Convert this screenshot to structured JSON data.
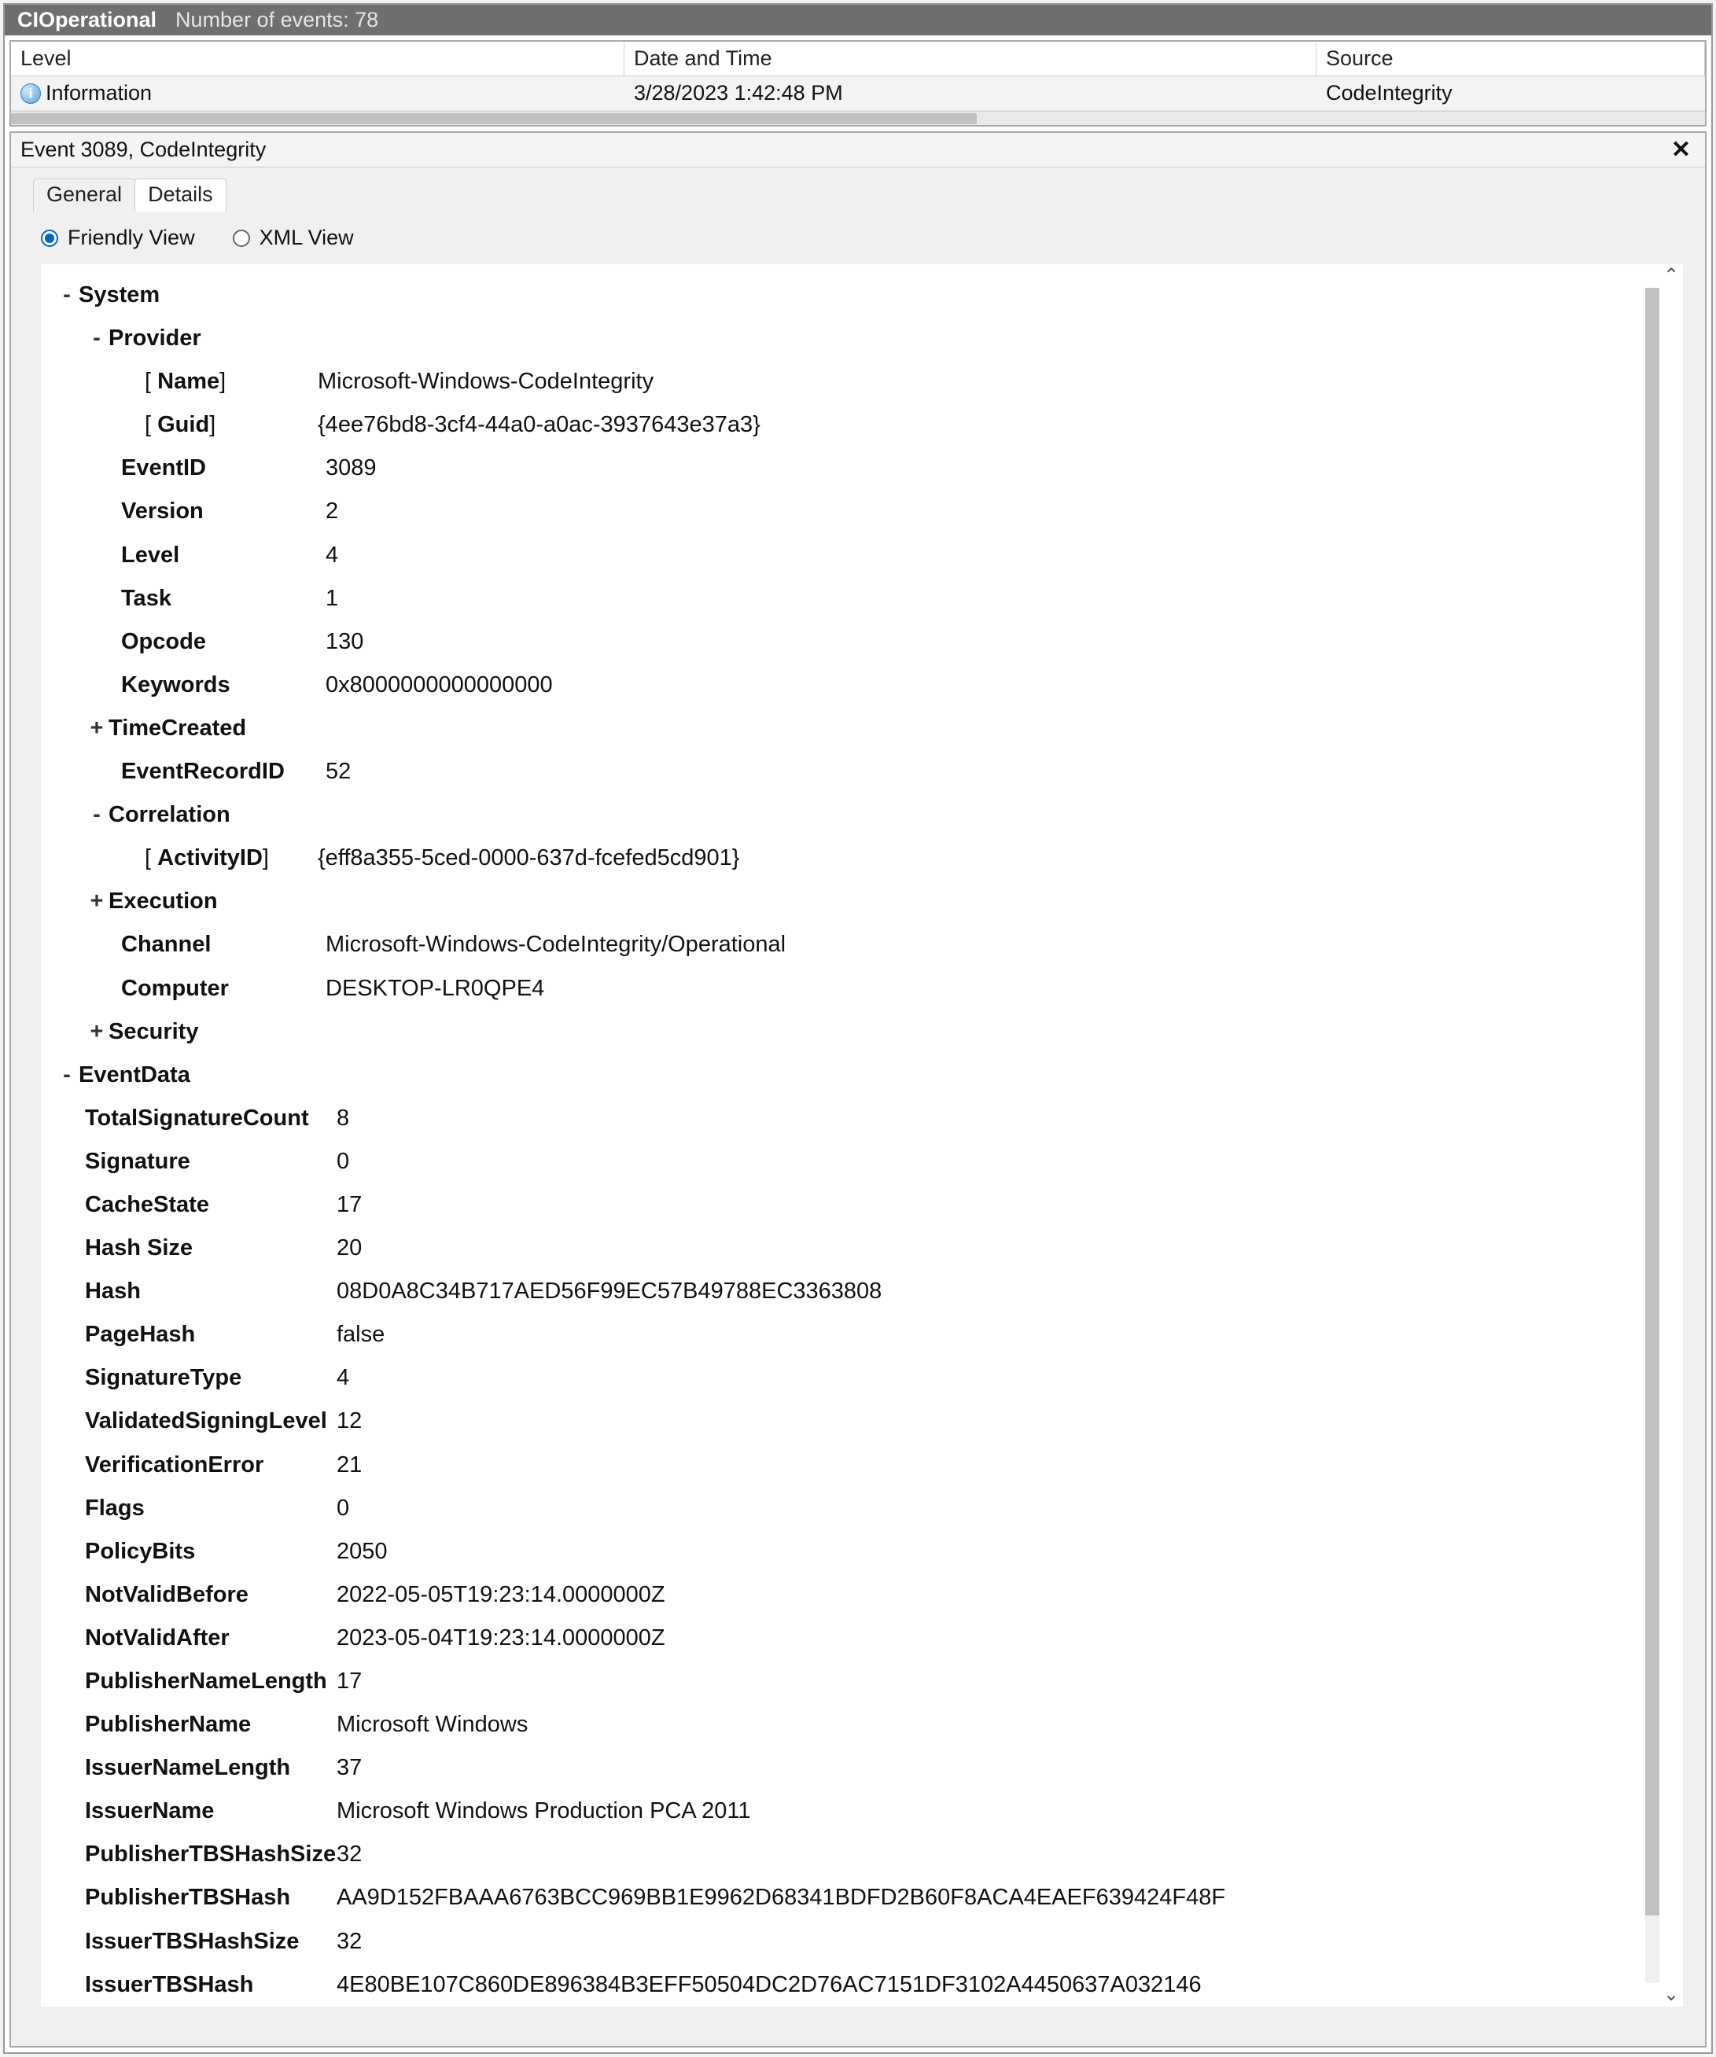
{
  "titlebar": {
    "name": "CIOperational",
    "count_label": "Number of events: 78"
  },
  "grid": {
    "headers": {
      "level": "Level",
      "date": "Date and Time",
      "source": "Source"
    },
    "rows": [
      {
        "level": "Information",
        "date": "3/28/2023 1:42:48 PM",
        "source": "CodeIntegrity"
      }
    ]
  },
  "detail_pane": {
    "title": "Event 3089, CodeIntegrity"
  },
  "tabs": {
    "general": "General",
    "details": "Details"
  },
  "viewmodes": {
    "friendly": "Friendly View",
    "xml": "XML View"
  },
  "tree": {
    "system": {
      "label": "System",
      "provider": {
        "label": "Provider",
        "name_label": "Name",
        "name_value": "Microsoft-Windows-CodeIntegrity",
        "guid_label": "Guid",
        "guid_value": "{4ee76bd8-3cf4-44a0-a0ac-3937643e37a3}"
      },
      "eventid": {
        "label": "EventID",
        "value": "3089"
      },
      "version": {
        "label": "Version",
        "value": "2"
      },
      "level": {
        "label": "Level",
        "value": "4"
      },
      "task": {
        "label": "Task",
        "value": "1"
      },
      "opcode": {
        "label": "Opcode",
        "value": "130"
      },
      "keywords": {
        "label": "Keywords",
        "value": "0x8000000000000000"
      },
      "timecreated": {
        "label": "TimeCreated"
      },
      "eventrecordid": {
        "label": "EventRecordID",
        "value": "52"
      },
      "correlation": {
        "label": "Correlation",
        "activityid_label": "ActivityID",
        "activityid_value": "{eff8a355-5ced-0000-637d-fcefed5cd901}"
      },
      "execution": {
        "label": "Execution"
      },
      "channel": {
        "label": "Channel",
        "value": "Microsoft-Windows-CodeIntegrity/Operational"
      },
      "computer": {
        "label": "Computer",
        "value": "DESKTOP-LR0QPE4"
      },
      "security": {
        "label": "Security"
      }
    },
    "eventdata": {
      "label": "EventData",
      "items": [
        {
          "k": "TotalSignatureCount",
          "v": "8"
        },
        {
          "k": "Signature",
          "v": "0"
        },
        {
          "k": "CacheState",
          "v": "17"
        },
        {
          "k": "Hash Size",
          "v": "20"
        },
        {
          "k": "Hash",
          "v": "08D0A8C34B717AED56F99EC57B49788EC3363808"
        },
        {
          "k": "PageHash",
          "v": "false"
        },
        {
          "k": "SignatureType",
          "v": "4"
        },
        {
          "k": "ValidatedSigningLevel",
          "v": "12"
        },
        {
          "k": "VerificationError",
          "v": "21"
        },
        {
          "k": "Flags",
          "v": "0"
        },
        {
          "k": "PolicyBits",
          "v": "2050"
        },
        {
          "k": "NotValidBefore",
          "v": "2022-05-05T19:23:14.0000000Z"
        },
        {
          "k": "NotValidAfter",
          "v": "2023-05-04T19:23:14.0000000Z"
        },
        {
          "k": "PublisherNameLength",
          "v": "17"
        },
        {
          "k": "PublisherName",
          "v": "Microsoft Windows"
        },
        {
          "k": "IssuerNameLength",
          "v": "37"
        },
        {
          "k": "IssuerName",
          "v": "Microsoft Windows Production PCA 2011"
        },
        {
          "k": "PublisherTBSHashSize",
          "v": "32"
        },
        {
          "k": "PublisherTBSHash",
          "v": "AA9D152FBAAA6763BCC969BB1E9962D68341BDFD2B60F8ACA4EAEF639424F48F"
        },
        {
          "k": "IssuerTBSHashSize",
          "v": "32"
        },
        {
          "k": "IssuerTBSHash",
          "v": "4E80BE107C860DE896384B3EFF50504DC2D76AC7151DF3102A4450637A032146"
        }
      ]
    }
  }
}
